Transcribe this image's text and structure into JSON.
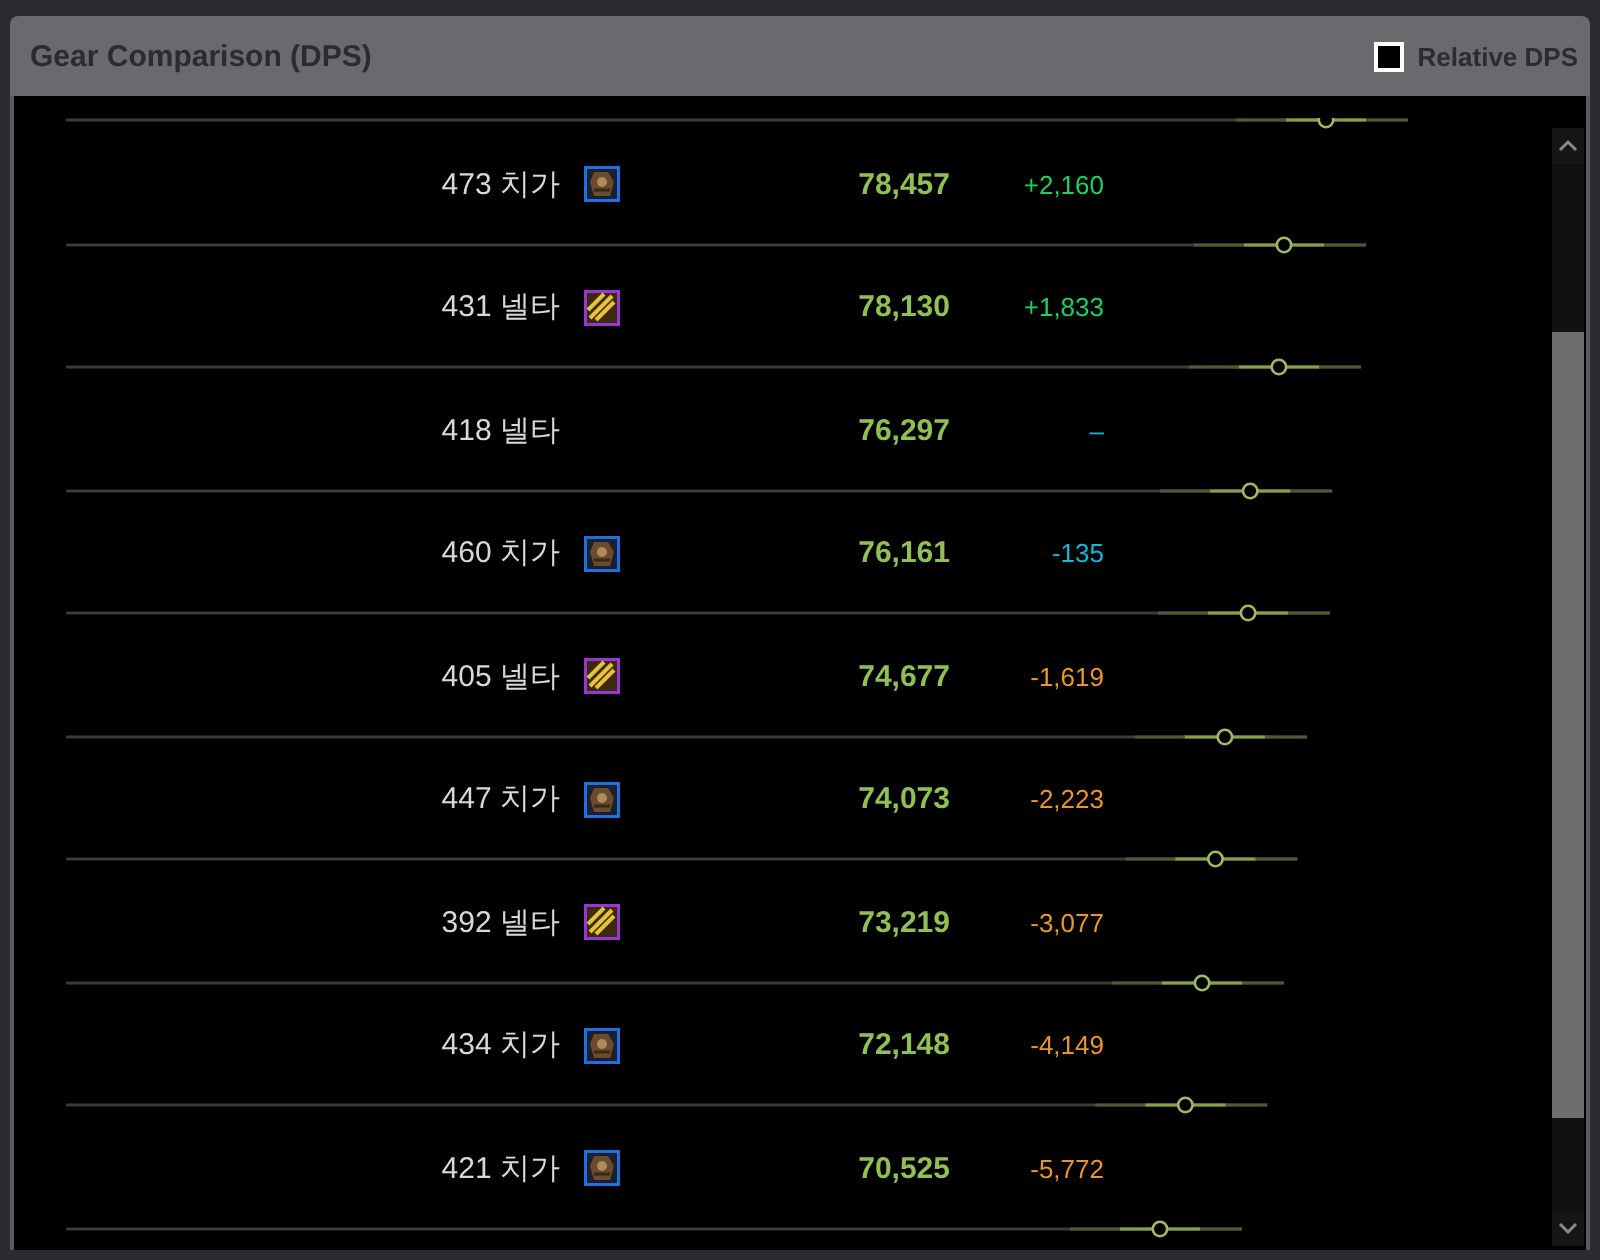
{
  "panel": {
    "title": "Gear Comparison (DPS)"
  },
  "relative_dps": {
    "label": "Relative DPS",
    "checked": false
  },
  "rows": [
    {
      "label": "473 치가",
      "kind": "armor",
      "dps": "78,457",
      "diff": "+2,160",
      "color": "#1fcf5f"
    },
    {
      "label": "431 넬타",
      "kind": "weapon",
      "dps": "78,130",
      "diff": "+1,833",
      "color": "#1fcf5f"
    },
    {
      "label": "418 넬타",
      "kind": "plain",
      "dps": "76,297",
      "diff": "–",
      "color": "#1ab4d8"
    },
    {
      "label": "460 치가",
      "kind": "armor",
      "dps": "76,161",
      "diff": "-135",
      "color": "#1ab4d8"
    },
    {
      "label": "405 넬타",
      "kind": "weapon",
      "dps": "74,677",
      "diff": "-1,619",
      "color": "#e8962a"
    },
    {
      "label": "447 치가",
      "kind": "armor",
      "dps": "74,073",
      "diff": "-2,223",
      "color": "#e8962a"
    },
    {
      "label": "392 넬타",
      "kind": "weapon",
      "dps": "73,219",
      "diff": "-3,077",
      "color": "#e8962a"
    },
    {
      "label": "434 치가",
      "kind": "armor",
      "dps": "72,148",
      "diff": "-4,149",
      "color": "#e8962a"
    },
    {
      "label": "421 치가",
      "kind": "armor",
      "dps": "70,525",
      "diff": "-5,772",
      "color": "#e8962a"
    }
  ]
}
